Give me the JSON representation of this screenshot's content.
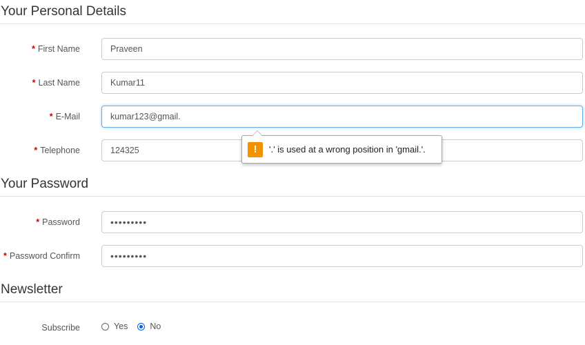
{
  "personal": {
    "title": "Your Personal Details",
    "first_name": {
      "label": "First Name",
      "value": "Praveen"
    },
    "last_name": {
      "label": "Last Name",
      "value": "Kumar11"
    },
    "email": {
      "label": "E-Mail",
      "value": "kumar123@gmail."
    },
    "telephone": {
      "label": "Telephone",
      "value": "124325"
    }
  },
  "validation_tooltip": {
    "icon": "!",
    "message": "'.' is used at a wrong position in 'gmail.'.",
    "icon_color": "#f29200"
  },
  "password_section": {
    "title": "Your Password",
    "password": {
      "label": "Password",
      "value": "•••••••••"
    },
    "confirm": {
      "label": "Password Confirm",
      "value": "•••••••••"
    }
  },
  "newsletter": {
    "title": "Newsletter",
    "subscribe_label": "Subscribe",
    "options": [
      {
        "label": "Yes",
        "checked": false
      },
      {
        "label": "No",
        "checked": true
      }
    ]
  },
  "required_marker": "*"
}
